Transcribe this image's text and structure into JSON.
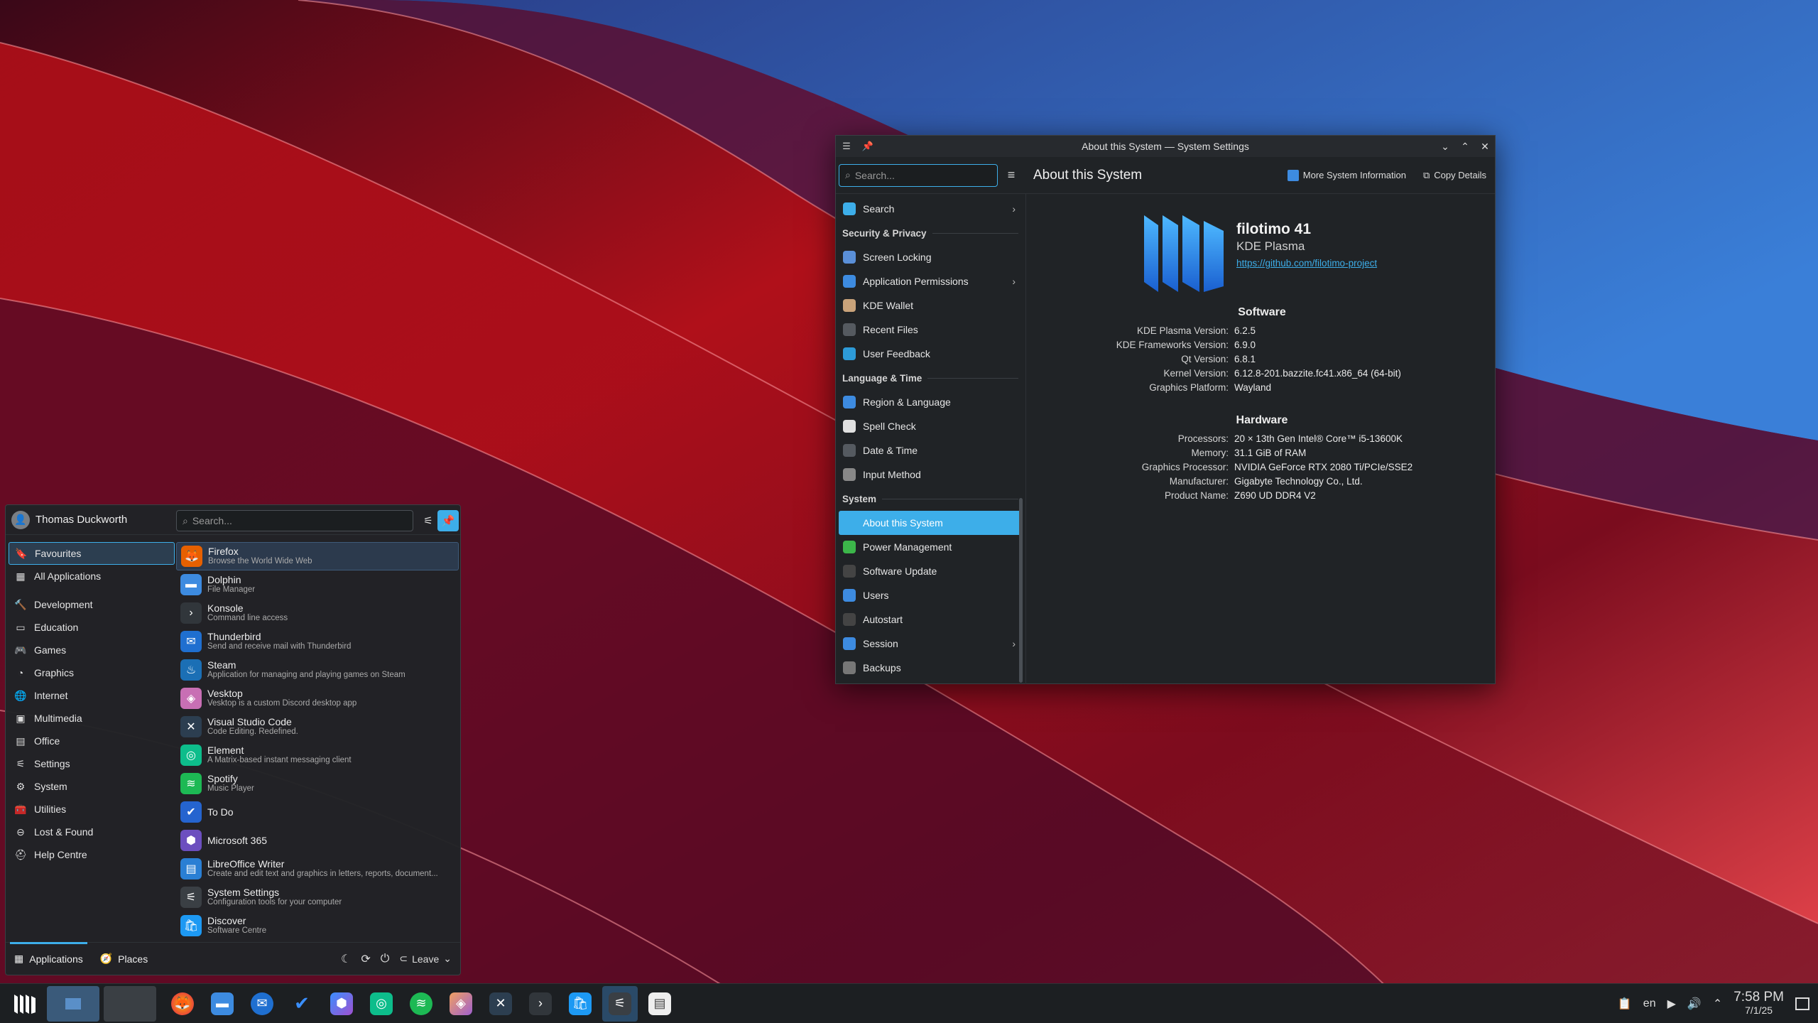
{
  "window": {
    "title": "About this System — System Settings",
    "search_placeholder": "Search...",
    "page_title": "About this System",
    "more_info": "More System Information",
    "copy_details": "Copy Details"
  },
  "sidebar": {
    "top": [
      {
        "label": "Search",
        "color": "#3daee9",
        "chevron": true
      }
    ],
    "groups": [
      {
        "header": "Security & Privacy",
        "items": [
          {
            "label": "Screen Locking",
            "color": "#5a8fd8"
          },
          {
            "label": "Application Permissions",
            "color": "#3d8be0",
            "chevron": true
          },
          {
            "label": "KDE Wallet",
            "color": "#c9a37a"
          },
          {
            "label": "Recent Files",
            "color": "#555a60"
          },
          {
            "label": "User Feedback",
            "color": "#2d9bd8"
          }
        ]
      },
      {
        "header": "Language & Time",
        "items": [
          {
            "label": "Region & Language",
            "color": "#3d8be0"
          },
          {
            "label": "Spell Check",
            "color": "#e0e0e0"
          },
          {
            "label": "Date & Time",
            "color": "#555a60"
          },
          {
            "label": "Input Method",
            "color": "#888"
          }
        ]
      },
      {
        "header": "System",
        "items": [
          {
            "label": "About this System",
            "color": "#3daee9",
            "active": true
          },
          {
            "label": "Power Management",
            "color": "#3cb64a"
          },
          {
            "label": "Software Update",
            "color": "#444"
          },
          {
            "label": "Users",
            "color": "#3d8be0"
          },
          {
            "label": "Autostart",
            "color": "#444"
          },
          {
            "label": "Session",
            "color": "#3d8be0",
            "chevron": true
          },
          {
            "label": "Backups",
            "color": "#777"
          }
        ]
      }
    ]
  },
  "distro": {
    "name": "filotimo 41",
    "desktop": "KDE Plasma",
    "url": "https://github.com/filotimo-project"
  },
  "software": {
    "heading": "Software",
    "rows": [
      {
        "k": "KDE Plasma Version:",
        "v": "6.2.5"
      },
      {
        "k": "KDE Frameworks Version:",
        "v": "6.9.0"
      },
      {
        "k": "Qt Version:",
        "v": "6.8.1"
      },
      {
        "k": "Kernel Version:",
        "v": "6.12.8-201.bazzite.fc41.x86_64 (64-bit)"
      },
      {
        "k": "Graphics Platform:",
        "v": "Wayland"
      }
    ]
  },
  "hardware": {
    "heading": "Hardware",
    "rows": [
      {
        "k": "Processors:",
        "v": "20 × 13th Gen Intel® Core™ i5-13600K"
      },
      {
        "k": "Memory:",
        "v": "31.1 GiB of RAM"
      },
      {
        "k": "Graphics Processor:",
        "v": "NVIDIA GeForce RTX 2080 Ti/PCIe/SSE2"
      },
      {
        "k": "Manufacturer:",
        "v": "Gigabyte Technology Co., Ltd."
      },
      {
        "k": "Product Name:",
        "v": "Z690 UD DDR4 V2"
      }
    ]
  },
  "menu": {
    "user": "Thomas Duckworth",
    "search_placeholder": "Search...",
    "categories": [
      {
        "label": "Favourites",
        "icon": "🔖",
        "active": true
      },
      {
        "label": "All Applications",
        "icon": "▦"
      },
      {
        "label": "Development",
        "icon": "🔨"
      },
      {
        "label": "Education",
        "icon": "▭"
      },
      {
        "label": "Games",
        "icon": "🎮"
      },
      {
        "label": "Graphics",
        "icon": "◔"
      },
      {
        "label": "Internet",
        "icon": "🌐"
      },
      {
        "label": "Multimedia",
        "icon": "▣"
      },
      {
        "label": "Office",
        "icon": "▤"
      },
      {
        "label": "Settings",
        "icon": "⚟"
      },
      {
        "label": "System",
        "icon": "⚙"
      },
      {
        "label": "Utilities",
        "icon": "🧰"
      },
      {
        "label": "Lost & Found",
        "icon": "⊖"
      },
      {
        "label": "Help Centre",
        "icon": "⛑"
      }
    ],
    "apps": [
      {
        "name": "Firefox",
        "desc": "Browse the World Wide Web",
        "color": "#e66000",
        "glyph": "🦊",
        "active": true
      },
      {
        "name": "Dolphin",
        "desc": "File Manager",
        "color": "#3d8be0",
        "glyph": "▬"
      },
      {
        "name": "Konsole",
        "desc": "Command line access",
        "color": "#31363b",
        "glyph": "›"
      },
      {
        "name": "Thunderbird",
        "desc": "Send and receive mail with Thunderbird",
        "color": "#1f6fd0",
        "glyph": "✉"
      },
      {
        "name": "Steam",
        "desc": "Application for managing and playing games on Steam",
        "color": "#1b6fb5",
        "glyph": "♨"
      },
      {
        "name": "Vesktop",
        "desc": "Vesktop is a custom Discord desktop app",
        "color": "#c86fb4",
        "glyph": "◈"
      },
      {
        "name": "Visual Studio Code",
        "desc": "Code Editing. Redefined.",
        "color": "#2c3e50",
        "glyph": "✕"
      },
      {
        "name": "Element",
        "desc": "A Matrix-based instant messaging client",
        "color": "#0dbd8b",
        "glyph": "◎"
      },
      {
        "name": "Spotify",
        "desc": "Music Player",
        "color": "#1db954",
        "glyph": "≋"
      },
      {
        "name": "To Do",
        "desc": "",
        "color": "#2564cf",
        "glyph": "✔"
      },
      {
        "name": "Microsoft 365",
        "desc": "",
        "color": "#6c4fbf",
        "glyph": "⬢"
      },
      {
        "name": "LibreOffice Writer",
        "desc": "Create and edit text and graphics in letters, reports, document...",
        "color": "#2a7fd4",
        "glyph": "▤"
      },
      {
        "name": "System Settings",
        "desc": "Configuration tools for your computer",
        "color": "#3a3f44",
        "glyph": "⚟"
      },
      {
        "name": "Discover",
        "desc": "Software Centre",
        "color": "#1d99f3",
        "glyph": "🛍"
      }
    ],
    "footer": {
      "applications": "Applications",
      "places": "Places",
      "leave": "Leave"
    }
  },
  "taskbar": {
    "time": "7:58 PM",
    "date": "7/1/25",
    "lang": "en"
  }
}
